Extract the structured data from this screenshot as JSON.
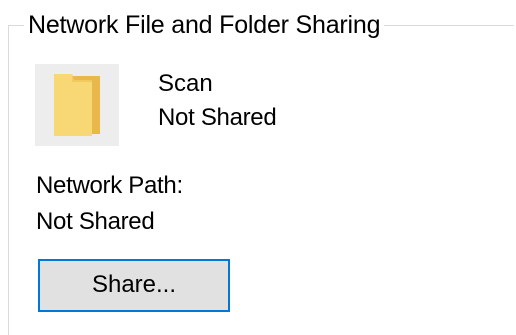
{
  "group": {
    "title": "Network File and Folder Sharing"
  },
  "item": {
    "icon": "folder-icon",
    "name": "Scan",
    "status": "Not Shared"
  },
  "network_path": {
    "label": "Network Path:",
    "value": "Not Shared"
  },
  "actions": {
    "share_label": "Share..."
  },
  "colors": {
    "button_border": "#0078d7",
    "button_face": "#e1e1e1",
    "icon_tile": "#ededed",
    "folder_light": "#f8d775",
    "folder_dark": "#e8b94a",
    "groupbox_line": "#dadada"
  }
}
